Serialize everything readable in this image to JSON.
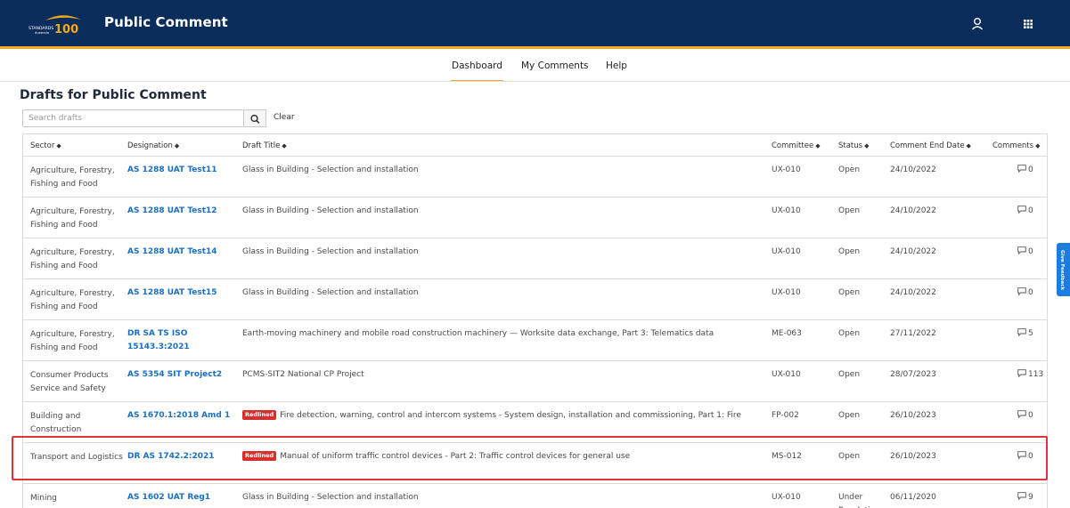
{
  "header": {
    "brand_text_top": "STANDARDS",
    "brand_text_bottom": "Australia",
    "brand_number": "100",
    "app_title": "Public Comment"
  },
  "nav": {
    "items": [
      {
        "label": "Dashboard",
        "active": true
      },
      {
        "label": "My Comments",
        "active": false
      },
      {
        "label": "Help",
        "active": false
      }
    ]
  },
  "page": {
    "title": "Drafts for Public Comment"
  },
  "search": {
    "placeholder": "Search drafts",
    "value": "",
    "clear_label": "Clear"
  },
  "table": {
    "headers": {
      "sector": "Sector",
      "designation": "Designation",
      "title": "Draft Title",
      "committee": "Committee",
      "status": "Status",
      "end_date": "Comment End Date",
      "comments": "Comments"
    },
    "rows": [
      {
        "sector": "Agriculture, Forestry, Fishing and Food",
        "designation": "AS 1288 UAT Test11",
        "badge": "",
        "title": "Glass in Building - Selection and installation",
        "committee": "UX-010",
        "status": "Open",
        "end_date": "24/10/2022",
        "comments": "0"
      },
      {
        "sector": "Agriculture, Forestry, Fishing and Food",
        "designation": "AS 1288 UAT Test12",
        "badge": "",
        "title": "Glass in Building - Selection and installation",
        "committee": "UX-010",
        "status": "Open",
        "end_date": "24/10/2022",
        "comments": "0"
      },
      {
        "sector": "Agriculture, Forestry, Fishing and Food",
        "designation": "AS 1288 UAT Test14",
        "badge": "",
        "title": "Glass in Building - Selection and installation",
        "committee": "UX-010",
        "status": "Open",
        "end_date": "24/10/2022",
        "comments": "0"
      },
      {
        "sector": "Agriculture, Forestry, Fishing and Food",
        "designation": "AS 1288 UAT Test15",
        "badge": "",
        "title": "Glass in Building - Selection and installation",
        "committee": "UX-010",
        "status": "Open",
        "end_date": "24/10/2022",
        "comments": "0"
      },
      {
        "sector": "Agriculture, Forestry, Fishing and Food",
        "designation": "DR SA TS ISO 15143.3:2021",
        "badge": "",
        "title": "Earth-moving machinery and mobile road construction machinery — Worksite data exchange, Part 3: Telematics data",
        "committee": "ME-063",
        "status": "Open",
        "end_date": "27/11/2022",
        "comments": "5"
      },
      {
        "sector": "Consumer Products Service and Safety",
        "designation": "AS 5354 SIT Project2",
        "badge": "",
        "title": "PCMS-SIT2 National CP Project",
        "committee": "UX-010",
        "status": "Open",
        "end_date": "28/07/2023",
        "comments": "113"
      },
      {
        "sector": "Building and Construction",
        "designation": "AS 1670.1:2018 Amd 1",
        "badge": "Redlined",
        "title": "Fire detection, warning, control and intercom systems - System design, installation and commissioning, Part 1: Fire",
        "committee": "FP-002",
        "status": "Open",
        "end_date": "26/10/2023",
        "comments": "0"
      },
      {
        "sector": "Transport and Logistics",
        "designation": "DR AS 1742.2:2021",
        "badge": "Redlined",
        "title": "Manual of uniform traffic control devices - Part 2: Traffic control devices for general use",
        "committee": "MS-012",
        "status": "Open",
        "end_date": "26/10/2023",
        "comments": "0"
      },
      {
        "sector": "Mining",
        "designation": "AS 1602 UAT Reg1",
        "badge": "",
        "title": "Glass in Building - Selection and installation",
        "committee": "UX-010",
        "status": "Under Resolution",
        "end_date": "06/11/2020",
        "comments": "9"
      }
    ]
  },
  "feedback": {
    "label": "Give Feedback"
  },
  "colors": {
    "header_bg": "#0b2d5c",
    "accent": "#f4a91d",
    "link": "#1a6fc2",
    "redlined_badge": "#d72e2e",
    "highlight_border": "#e0343a",
    "feedback_tab": "#1d7ce0"
  },
  "icons": {
    "user": "user-icon",
    "apps": "apps-grid-icon",
    "search": "search-icon",
    "sort": "sort-icon",
    "comment": "comment-icon"
  }
}
